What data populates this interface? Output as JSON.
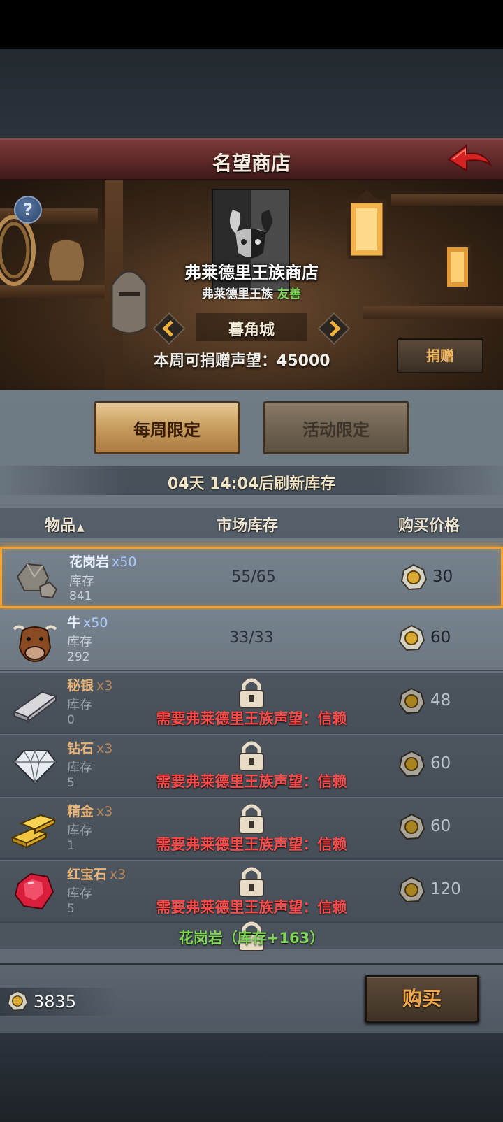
{
  "header": {
    "title": "名望商店"
  },
  "shop": {
    "name": "弗莱德里王族商店",
    "faction": "弗莱德里王族",
    "attitude": "友善",
    "city": "暮角城",
    "donate_label": "本周可捐赠声望：",
    "donate_value": "45000",
    "donate_button": "捐赠",
    "help": "?"
  },
  "tabs": [
    {
      "label": "每周限定",
      "active": true
    },
    {
      "label": "活动限定",
      "active": false
    }
  ],
  "refresh_text": "04天 14:04后刷新库存",
  "columns": {
    "item": "物品",
    "market": "市场库存",
    "price": "购买价格"
  },
  "items": [
    {
      "name": "花岗岩",
      "qty": "x50",
      "stock_label": "库存",
      "stock": "841",
      "market": "55/65",
      "price": "30",
      "locked": false,
      "selected": true,
      "icon": "granite-icon"
    },
    {
      "name": "牛",
      "qty": "x50",
      "stock_label": "库存",
      "stock": "292",
      "market": "33/33",
      "price": "60",
      "locked": false,
      "selected": false,
      "icon": "cow-icon"
    },
    {
      "name": "秘银",
      "qty": "x3",
      "stock_label": "库存",
      "stock": "0",
      "lock_msg": "需要弗莱德里王族声望：信赖",
      "price": "48",
      "locked": true,
      "icon": "mithril-icon"
    },
    {
      "name": "钻石",
      "qty": "x3",
      "stock_label": "库存",
      "stock": "5",
      "lock_msg": "需要弗莱德里王族声望：信赖",
      "price": "60",
      "locked": true,
      "icon": "diamond-icon"
    },
    {
      "name": "精金",
      "qty": "x3",
      "stock_label": "库存",
      "stock": "1",
      "lock_msg": "需要弗莱德里王族声望：信赖",
      "price": "60",
      "locked": true,
      "icon": "gold-bar-icon"
    },
    {
      "name": "红宝石",
      "qty": "x3",
      "stock_label": "库存",
      "stock": "5",
      "lock_msg": "需要弗莱德里王族声望：信赖",
      "price": "120",
      "locked": true,
      "icon": "ruby-icon"
    }
  ],
  "bottom_hint": "花岗岩（库存+163）",
  "footer": {
    "balance": "3835",
    "buy_button": "购买"
  },
  "colors": {
    "selected_border": "#f5a02a",
    "lock_text": "#ff4a4a",
    "friendly": "#7ed35a",
    "title_bar": "#5a2626"
  }
}
